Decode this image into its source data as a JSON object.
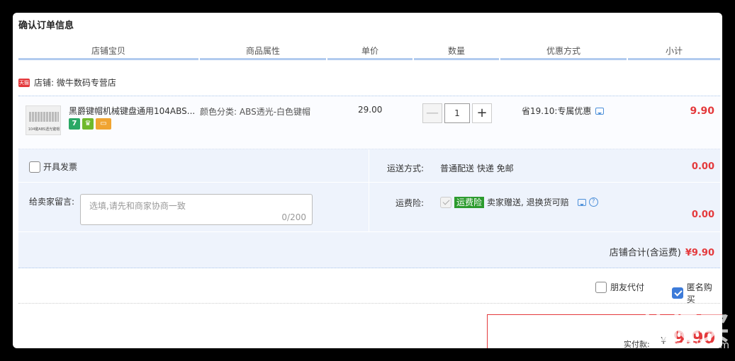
{
  "title": "确认订单信息",
  "columns": [
    "店铺宝贝",
    "商品属性",
    "单价",
    "数量",
    "优惠方式",
    "小计"
  ],
  "store": {
    "icon_text": "天猫",
    "name": "店铺: 微牛数码专营店"
  },
  "item": {
    "thumb_caption": "104键ABS透光键帽",
    "name": "黑爵键帽机械键盘通用104ABS...",
    "badges": [
      "7",
      "♛",
      "▭"
    ],
    "attribute": "颜色分类: ABS透光-白色键帽",
    "price": "29.00",
    "qty_minus": "—",
    "quantity": "1",
    "qty_plus": "+",
    "promo": "省19.10:专属优惠",
    "subtotal": "9.90"
  },
  "options": {
    "invoice_label": "开具发票",
    "shipping_label": "运送方式:",
    "shipping_value": "普通配送 快递 免邮",
    "shipping_amount": "0.00",
    "memo_label": "给卖家留言:",
    "memo_placeholder": "选填,请先和商家协商一致",
    "memo_count": "0/200",
    "insurance_label": "运费险:",
    "insurance_tag": "运费险",
    "insurance_text": "卖家赠送, 退换货可赔",
    "insurance_amount": "0.00",
    "help_glyph": "?",
    "store_total_label": "店铺合计(含运费)",
    "store_total_value": "¥9.90"
  },
  "bottom": {
    "friend_pay": "朋友代付",
    "anonymous": "匿名购买"
  },
  "payment": {
    "label": "实付款:",
    "currency": "¥",
    "amount": "9.90"
  },
  "watermark": {
    "text": "值得买",
    "url": "zhizhi.com"
  },
  "colors": {
    "accent_red": "#e4393c",
    "header_line": "#b2cbef",
    "options_bg": "#eef3fc",
    "checkbox_blue": "#3d7bd9"
  }
}
